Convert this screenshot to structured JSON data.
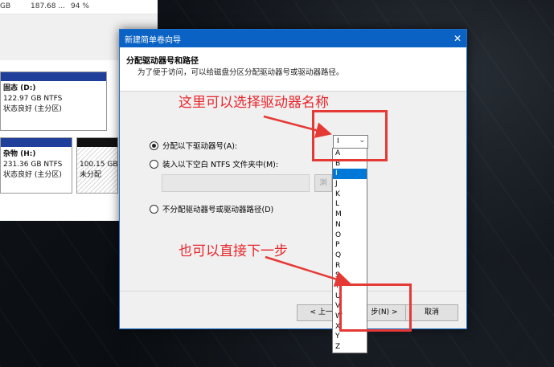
{
  "diskmgmt": {
    "top_row": {
      "col1": "GB",
      "col2": "187.68 ...",
      "col3": "94 %"
    },
    "volumes": [
      {
        "name": "固态  (D:)",
        "size": "122.97 GB NTFS",
        "status": "状态良好 (主分区)"
      },
      {
        "name": "杂物  (H:)",
        "size": "231.36 GB NTFS",
        "status": "状态良好 (主分区)"
      },
      {
        "name": "",
        "size": "100.15 GB",
        "status": "未分配"
      }
    ]
  },
  "dialog": {
    "title": "新建简单卷向导",
    "close": "✕",
    "header_title": "分配驱动器号和路径",
    "header_desc": "为了便于访问，可以给磁盘分区分配驱动器号或驱动器路径。",
    "option_assign": "分配以下驱动器号(A):",
    "option_mount": "装入以下空白 NTFS 文件夹中(M):",
    "option_none": "不分配驱动器号或驱动器路径(D)",
    "selected_letter": "I",
    "browse_label": "浏",
    "back_label": "< 上一步(",
    "next_label": "步(N) >",
    "cancel_label": "取消"
  },
  "dropdown_letters": [
    "A",
    "B",
    "I",
    "J",
    "K",
    "L",
    "M",
    "N",
    "O",
    "P",
    "Q",
    "R",
    "S",
    "T",
    "U",
    "V",
    "W",
    "X",
    "Y",
    "Z"
  ],
  "dropdown_selected": "I",
  "annotations": {
    "top": "这里可以选择驱动器名称",
    "bottom": "也可以直接下一步"
  },
  "colors": {
    "accent": "#0a63c4",
    "selection": "#0078d7",
    "annotation": "#e53935",
    "volume_bar": "#1f3f9a"
  }
}
